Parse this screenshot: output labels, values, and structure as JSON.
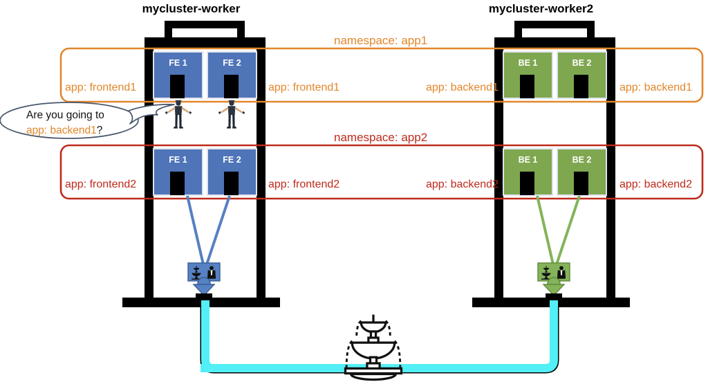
{
  "diagram": {
    "type": "kubernetes-namespace-architecture",
    "title_left": "mycluster-worker",
    "title_right": "mycluster-worker2",
    "colors": {
      "namespace1": "#E2872B",
      "namespace2": "#BE2A1C",
      "frontend_pod": "#4F74B8",
      "backend_pod": "#7FA74F",
      "pipe": "#53EFF7",
      "structure": "#000000",
      "bubble_stroke": "#48566B"
    }
  },
  "workers": [
    {
      "id": "worker1",
      "name": "mycluster-worker"
    },
    {
      "id": "worker2",
      "name": "mycluster-worker2"
    }
  ],
  "namespaces": [
    {
      "id": "app1",
      "label": "namespace: app1",
      "color": "#E2872B",
      "left_outer_label": "app: frontend1",
      "left_inner_label": "app: frontend1",
      "right_inner_label": "app: backend1",
      "right_outer_label": "app: backend1"
    },
    {
      "id": "app2",
      "label": "namespace: app2",
      "color": "#BE2A1C",
      "left_outer_label": "app: frontend2",
      "left_inner_label": "app: frontend2",
      "right_inner_label": "app: backend2",
      "right_outer_label": "app: backend2"
    }
  ],
  "pods": {
    "worker1_app1": [
      {
        "name": "FE 1",
        "kind": "frontend"
      },
      {
        "name": "FE 2",
        "kind": "frontend"
      }
    ],
    "worker1_app2": [
      {
        "name": "FE 1",
        "kind": "frontend"
      },
      {
        "name": "FE 2",
        "kind": "frontend"
      }
    ],
    "worker2_app1": [
      {
        "name": "BE 1",
        "kind": "backend"
      },
      {
        "name": "BE 2",
        "kind": "backend"
      }
    ],
    "worker2_app2": [
      {
        "name": "BE 1",
        "kind": "backend"
      },
      {
        "name": "BE 2",
        "kind": "backend"
      }
    ]
  },
  "speech_bubble": {
    "line1": "Are you going to",
    "line2_highlight": "app: backend1",
    "line2_suffix": "?"
  },
  "icons": {
    "service_left": "service-icon",
    "service_right": "service-icon",
    "fountain": "fountain-icon",
    "people": [
      "person-icon",
      "person-icon"
    ]
  }
}
